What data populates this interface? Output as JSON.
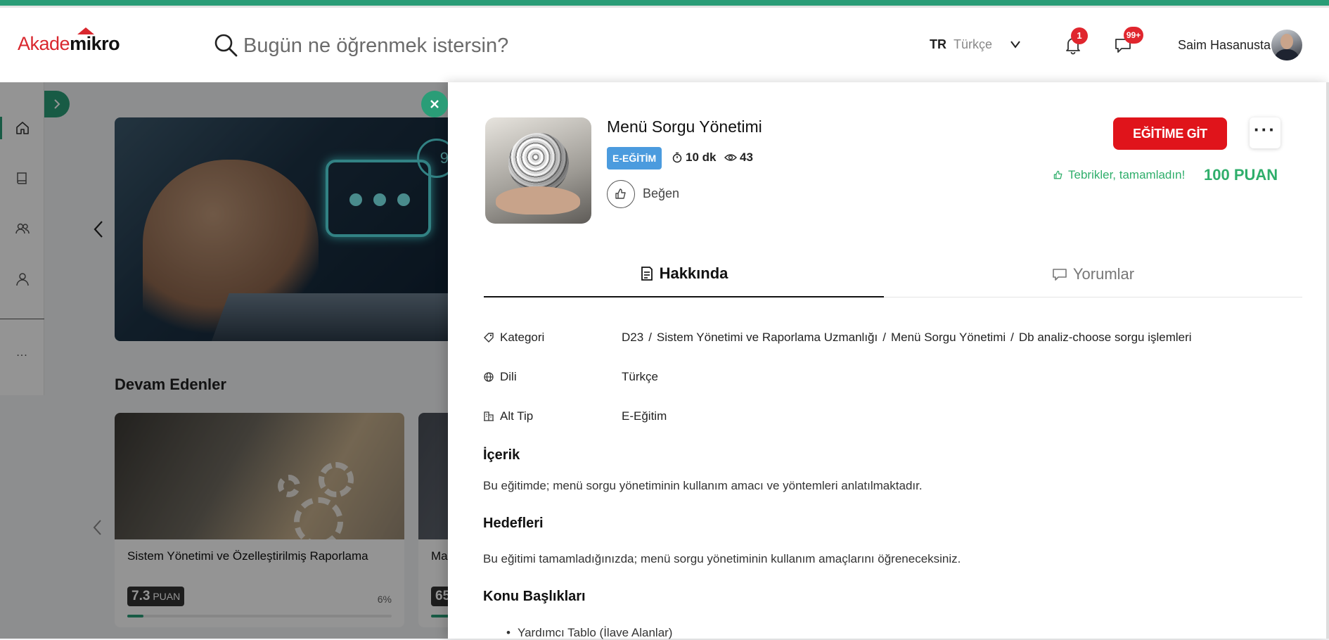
{
  "header": {
    "logo_part1": "Akade",
    "logo_part2": "mikro",
    "search_placeholder": "Bugün ne öğrenmek istersin?",
    "lang_code": "TR",
    "lang_name": "Türkçe",
    "notification_count": "1",
    "message_count": "99+",
    "user_name": "Saim Hasanusta"
  },
  "sidebar": {
    "items": [
      {
        "icon": "home-icon"
      },
      {
        "icon": "book-icon"
      },
      {
        "icon": "users-icon"
      },
      {
        "icon": "user-icon"
      }
    ],
    "more_label": "..."
  },
  "background": {
    "section_title": "Devam Edenler",
    "hero_bell_count": "9",
    "cards": [
      {
        "title": "Sistem Yönetimi ve Özelleştirilmiş Raporlama",
        "points": "7.3",
        "points_unit": "PUAN",
        "progress_label": "6%",
        "progress": 0.06
      },
      {
        "title": "Ma",
        "points": "65",
        "points_unit": "",
        "progress_label": "",
        "progress": 0.1
      }
    ]
  },
  "panel": {
    "title": "Menü Sorgu Yönetimi",
    "type_badge": "E-EĞİTİM",
    "duration": "10 dk",
    "views": "43",
    "like_label": "Beğen",
    "go_button": "EĞİTİME GİT",
    "more_label": "···",
    "congrats": "Tebrikler, tamamladın!",
    "points": "100 PUAN",
    "tabs": [
      {
        "label": "Hakkında",
        "active": true
      },
      {
        "label": "Yorumlar",
        "active": false
      }
    ],
    "info": {
      "category_label": "Kategori",
      "category_path": [
        "D23",
        "Sistem Yönetimi ve Raporlama Uzmanlığı",
        "Menü Sorgu Yönetimi",
        "Db analiz-choose sorgu işlemleri"
      ],
      "language_label": "Dili",
      "language_value": "Türkçe",
      "subtype_label": "Alt Tip",
      "subtype_value": "E-Eğitim"
    },
    "content_heading": "İçerik",
    "content_text": "Bu eğitimde; menü sorgu yönetiminin kullanım amacı ve yöntemleri anlatılmaktadır.",
    "goals_heading": "Hedefleri",
    "goals_text": "Bu eğitimi tamamladığınızda; menü sorgu yönetiminin kullanım amaçlarını öğreneceksiniz.",
    "topics_heading": "Konu Başlıkları",
    "topics": [
      "Yardımcı Tablo (İlave Alanlar)"
    ]
  },
  "colors": {
    "brand_green": "#2a9d77",
    "brand_red": "#e0141b",
    "badge_blue": "#4b9bde",
    "success_green": "#2fae6b"
  }
}
